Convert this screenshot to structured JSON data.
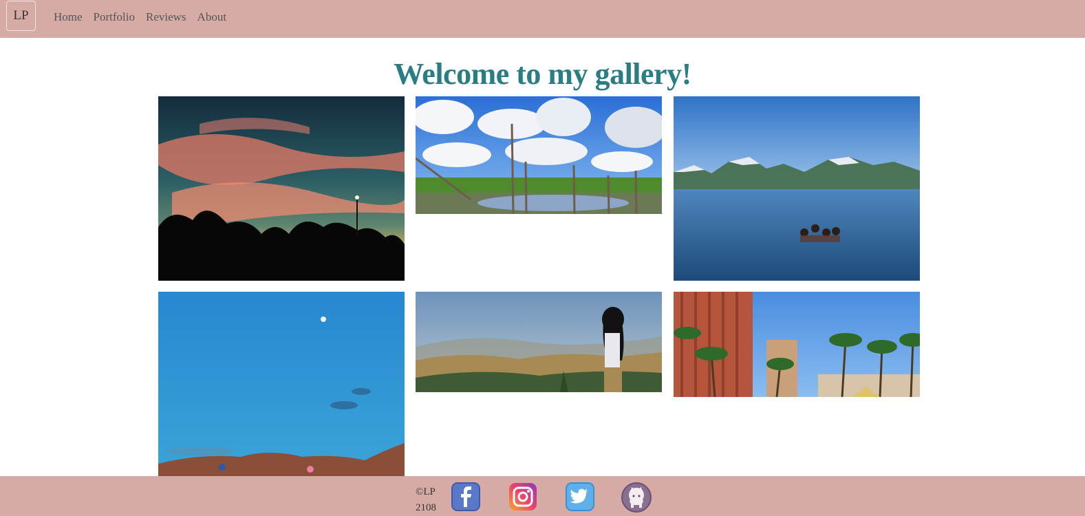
{
  "nav": {
    "brand": "LP",
    "links": [
      "Home",
      "Portfolio",
      "Reviews",
      "About"
    ]
  },
  "main": {
    "title": "Welcome to my gallery!"
  },
  "gallery": {
    "photos": [
      {
        "subject": "sunset over trees silhouette"
      },
      {
        "subject": "clouds over fenced pond"
      },
      {
        "subject": "mountain lake with swimmers"
      },
      {
        "subject": "blue evening sky with moon"
      },
      {
        "subject": "girl overlooking hills"
      },
      {
        "subject": "palm trees and hotel towers"
      }
    ]
  },
  "footer": {
    "copyright_line1": "©LP",
    "copyright_line2": "2108",
    "social": [
      {
        "icon": "facebook-icon"
      },
      {
        "icon": "instagram-icon"
      },
      {
        "icon": "twitter-icon"
      },
      {
        "icon": "github-icon"
      }
    ]
  },
  "colors": {
    "navbar": "#d6aba6",
    "title": "#2a7d83",
    "footer": "#d6aba6"
  }
}
